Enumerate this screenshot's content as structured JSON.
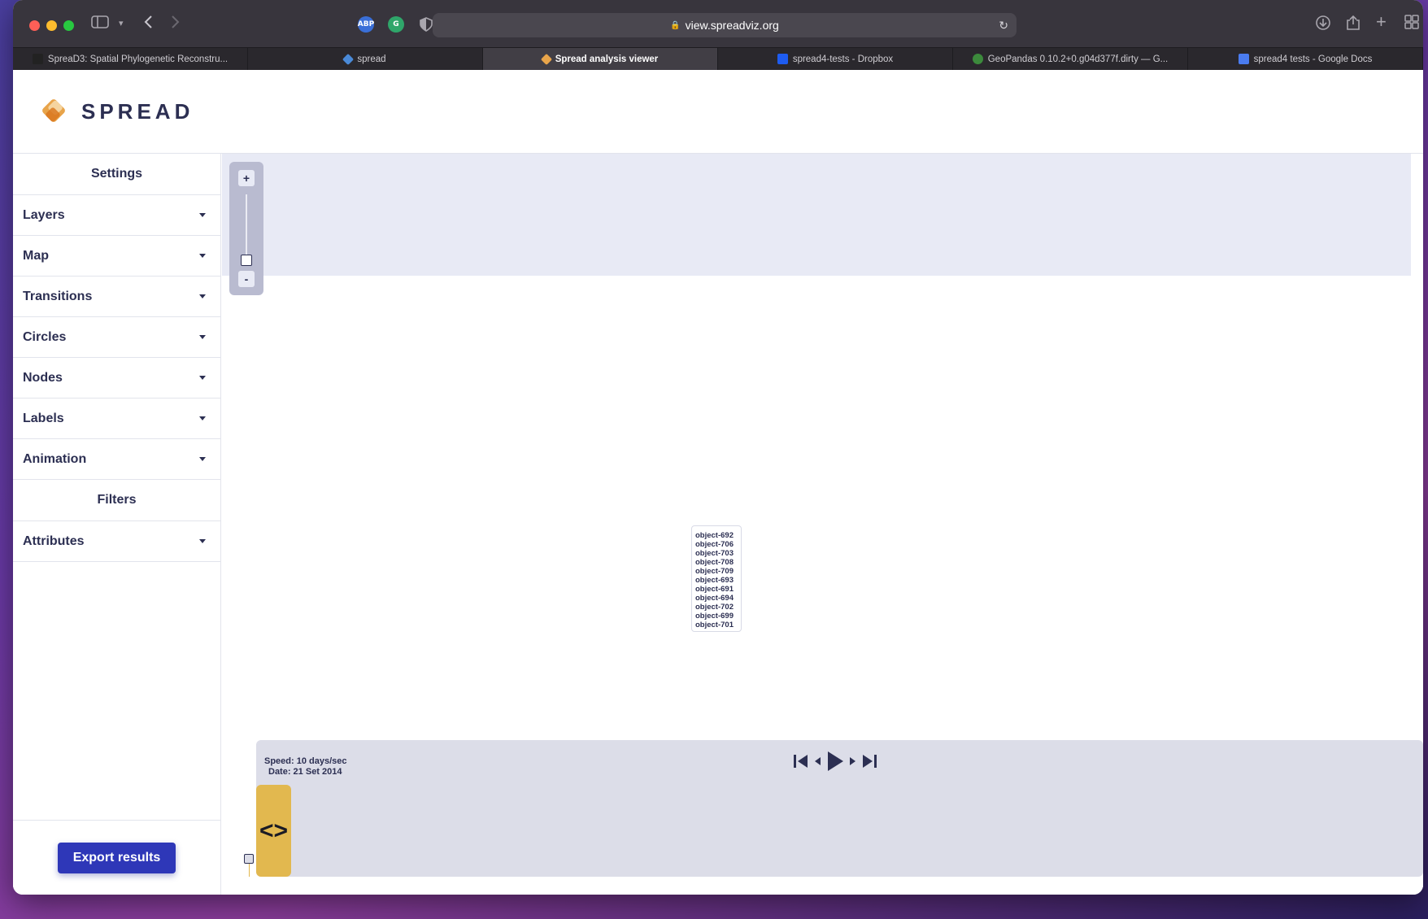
{
  "browser": {
    "url": "view.spreadviz.org",
    "tabs": [
      {
        "label": "SpreaD3: Spatial Phylogenetic Reconstru...",
        "active": false,
        "icon_color": "#222222"
      },
      {
        "label": "spread",
        "active": false,
        "icon_color": "#4a8ad8"
      },
      {
        "label": "Spread analysis viewer",
        "active": true,
        "icon_color": "#e8a44a"
      },
      {
        "label": "spread4-tests - Dropbox",
        "active": false,
        "icon_color": "#1e5cf0"
      },
      {
        "label": "GeoPandas 0.10.2+0.g04d377f.dirty — G...",
        "active": false,
        "icon_color": "#3c8a3c"
      },
      {
        "label": "spread4 tests - Google Docs",
        "active": false,
        "icon_color": "#4a7cf0"
      }
    ],
    "extensions": [
      {
        "name": "adblock-icon",
        "label": "ABP",
        "color": "#3a6fd8"
      },
      {
        "name": "grammarly-icon",
        "label": "G",
        "color": "#2fa66a"
      },
      {
        "name": "privacy-shield-icon",
        "label": "",
        "color": "#a9a6ae"
      }
    ]
  },
  "app": {
    "logo_text": "SPREAD",
    "sidebar": {
      "settings_heading": "Settings",
      "items": [
        {
          "label": "Layers",
          "name": "layers"
        },
        {
          "label": "Map",
          "name": "map"
        },
        {
          "label": "Transitions",
          "name": "transitions"
        },
        {
          "label": "Circles",
          "name": "circles"
        },
        {
          "label": "Nodes",
          "name": "nodes"
        },
        {
          "label": "Labels",
          "name": "labels"
        },
        {
          "label": "Animation",
          "name": "animation"
        }
      ],
      "filters_heading": "Filters",
      "filter_items": [
        {
          "label": "Attributes",
          "name": "attributes"
        }
      ],
      "export_label": "Export results"
    },
    "map": {
      "zoom_in": "+",
      "zoom_out": "-",
      "object_labels": [
        "object-692",
        "object-706",
        "object-703",
        "object-708",
        "object-709",
        "object-693",
        "object-691",
        "object-694",
        "object-702",
        "object-699",
        "object-701"
      ]
    },
    "timeline": {
      "speed_text": "Speed: 10 days/sec",
      "date_text": "Date: 21 Set 2014",
      "handle_glyph": "<>"
    }
  },
  "colors": {
    "accent": "#2e37b8",
    "navy_text": "#2c2f52",
    "timeline_handle": "#e2b84f",
    "map_band": "#e8eaf5",
    "timeline_bg": "#dcdde8"
  }
}
